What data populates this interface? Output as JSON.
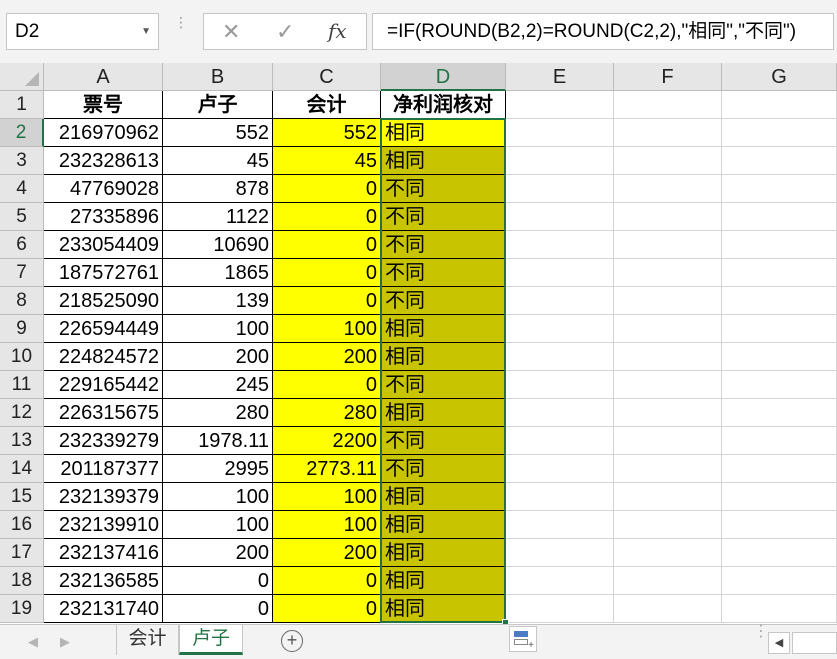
{
  "formula_bar": {
    "name_box": "D2",
    "cancel_icon": "✕",
    "enter_icon": "✓",
    "fx_label": "fx",
    "formula": "=IF(ROUND(B2,2)=ROUND(C2,2),\"相同\",\"不同\")"
  },
  "columns": [
    "A",
    "B",
    "C",
    "D",
    "E",
    "F",
    "G"
  ],
  "selected_column": "D",
  "header_row": {
    "row": "1",
    "cells": [
      "票号",
      "卢子",
      "会计",
      "净利润核对"
    ]
  },
  "rows": [
    {
      "row": "2",
      "a": "216970962",
      "b": "552",
      "c": "552",
      "d": "相同"
    },
    {
      "row": "3",
      "a": "232328613",
      "b": "45",
      "c": "45",
      "d": "相同"
    },
    {
      "row": "4",
      "a": "47769028",
      "b": "878",
      "c": "0",
      "d": "不同"
    },
    {
      "row": "5",
      "a": "27335896",
      "b": "1122",
      "c": "0",
      "d": "不同"
    },
    {
      "row": "6",
      "a": "233054409",
      "b": "10690",
      "c": "0",
      "d": "不同"
    },
    {
      "row": "7",
      "a": "187572761",
      "b": "1865",
      "c": "0",
      "d": "不同"
    },
    {
      "row": "8",
      "a": "218525090",
      "b": "139",
      "c": "0",
      "d": "不同"
    },
    {
      "row": "9",
      "a": "226594449",
      "b": "100",
      "c": "100",
      "d": "相同"
    },
    {
      "row": "10",
      "a": "224824572",
      "b": "200",
      "c": "200",
      "d": "相同"
    },
    {
      "row": "11",
      "a": "229165442",
      "b": "245",
      "c": "0",
      "d": "不同"
    },
    {
      "row": "12",
      "a": "226315675",
      "b": "280",
      "c": "280",
      "d": "相同"
    },
    {
      "row": "13",
      "a": "232339279",
      "b": "1978.11",
      "c": "2200",
      "d": "不同"
    },
    {
      "row": "14",
      "a": "201187377",
      "b": "2995",
      "c": "2773.11",
      "d": "不同"
    },
    {
      "row": "15",
      "a": "232139379",
      "b": "100",
      "c": "100",
      "d": "相同"
    },
    {
      "row": "16",
      "a": "232139910",
      "b": "100",
      "c": "100",
      "d": "相同"
    },
    {
      "row": "17",
      "a": "232137416",
      "b": "200",
      "c": "200",
      "d": "相同"
    },
    {
      "row": "18",
      "a": "232136585",
      "b": "0",
      "c": "0",
      "d": "相同"
    },
    {
      "row": "19",
      "a": "232131740",
      "b": "0",
      "c": "0",
      "d": "相同"
    }
  ],
  "sheet_tabs": [
    "会计",
    "卢子"
  ],
  "active_sheet": "卢子",
  "add_sheet_icon": "+",
  "colors": {
    "accent": "#217346",
    "yellow_fill": "#FFFF00",
    "selection_fill": "#C8C400"
  }
}
